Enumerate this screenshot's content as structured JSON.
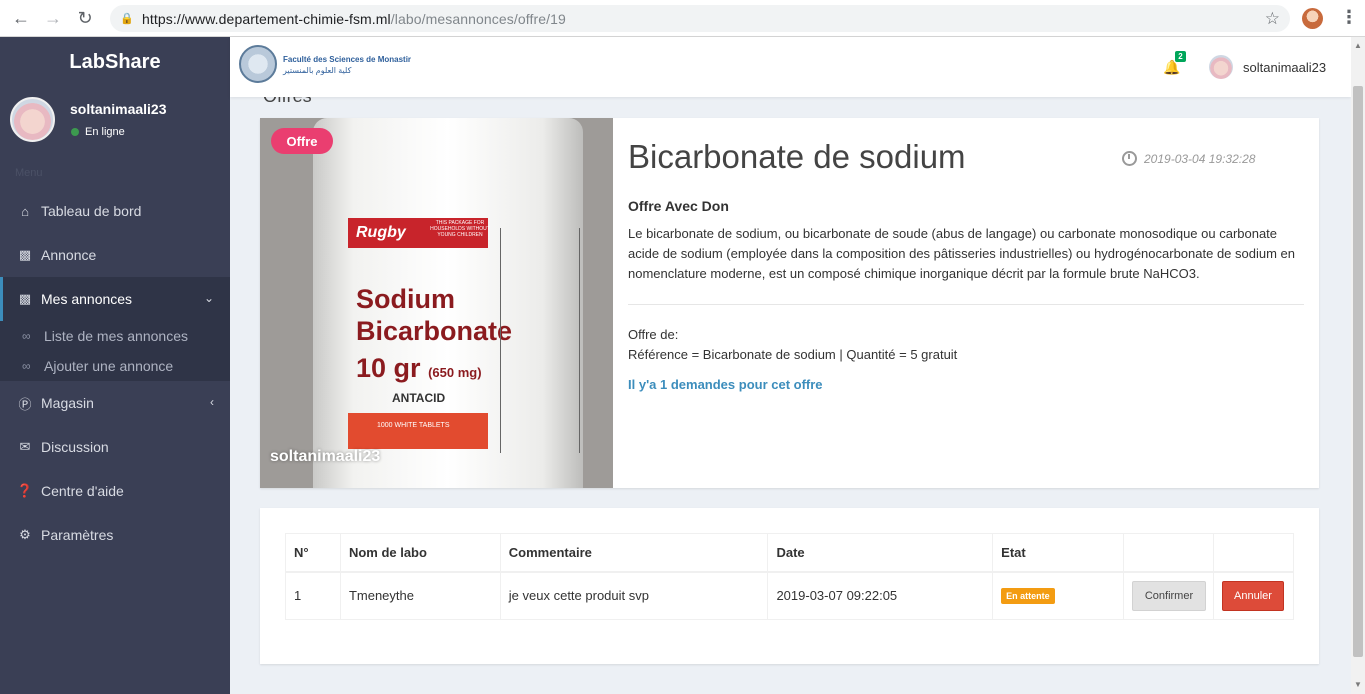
{
  "browser": {
    "url_host": "https://www.departement-chimie-fsm.ml",
    "url_path": "/labo/mesannonces/offre/19"
  },
  "sidebar": {
    "brand": "LabShare",
    "user": {
      "name": "soltanimaali23",
      "status": "En ligne"
    },
    "menu_header": "Menu",
    "items": [
      {
        "label": "Tableau de bord",
        "icon": "home-icon"
      },
      {
        "label": "Annonce",
        "icon": "basket-icon"
      },
      {
        "label": "Mes annonces",
        "icon": "basket-icon",
        "active": true
      },
      {
        "label": "Magasin",
        "icon": "parking-circle-icon"
      },
      {
        "label": "Discussion",
        "icon": "envelope-icon"
      },
      {
        "label": "Centre d'aide",
        "icon": "question-circle-icon"
      },
      {
        "label": "Paramètres",
        "icon": "gear-icon"
      }
    ],
    "subitems": [
      {
        "label": "Liste de mes annonces",
        "icon": "link-icon"
      },
      {
        "label": "Ajouter une annonce",
        "icon": "link-icon"
      }
    ]
  },
  "topbar": {
    "logo_fr": "Faculté des Sciences de Monastir",
    "logo_ar": "كلية العلوم بالمنستير",
    "notification_count": "2",
    "username": "soltanimaali23"
  },
  "peek": {
    "title": "Offres"
  },
  "offer": {
    "tag": "Offre",
    "title": "Bicarbonate de sodium",
    "date": "2019-03-04 19:32:28",
    "type": "Offre Avec Don",
    "description": " Le bicarbonate de sodium, ou bicarbonate de soude (abus de langage) ou carbonate monosodique ou carbonate acide de sodium (employée dans la composition des pâtisseries industrielles) ou hydrogénocarbonate de sodium en nomenclature moderne, est un composé chimique inorganique décrit par la formule brute NaHCO3.",
    "offer_de_label": "Offre de:",
    "reference_line": "Référence = Bicarbonate de sodium | Quantité = 5 gratuit",
    "demands_link": "Il y'a 1 demandes pour cet offre",
    "image": {
      "brand": "Rugby",
      "warning": "THIS PACKAGE FOR HOUSEHOLDS WITHOUT YOUNG CHILDREN",
      "name_line1": "Sodium",
      "name_line2": "Bicarbonate",
      "dose": "10 gr",
      "dose_mg": "(650 mg)",
      "antacid": "ANTACID",
      "tablets": "1000 WHITE TABLETS",
      "caption": "soltanimaali23"
    }
  },
  "requests_table": {
    "headers": [
      "N°",
      "Nom de labo",
      "Commentaire",
      "Date",
      "Etat",
      "",
      ""
    ],
    "rows": [
      {
        "num": "1",
        "labo": "Tmeneythe",
        "comment": "je veux cette produit svp",
        "date": "2019-03-07 09:22:05",
        "state": "En attente",
        "confirm_label": "Confirmer",
        "cancel_label": "Annuler"
      }
    ]
  },
  "colors": {
    "sidebar_bg": "#3a3f55",
    "accent": "#3c8dbc",
    "offer_tag": "#ea3e70",
    "pending": "#f39c12",
    "danger": "#dd4b39"
  }
}
